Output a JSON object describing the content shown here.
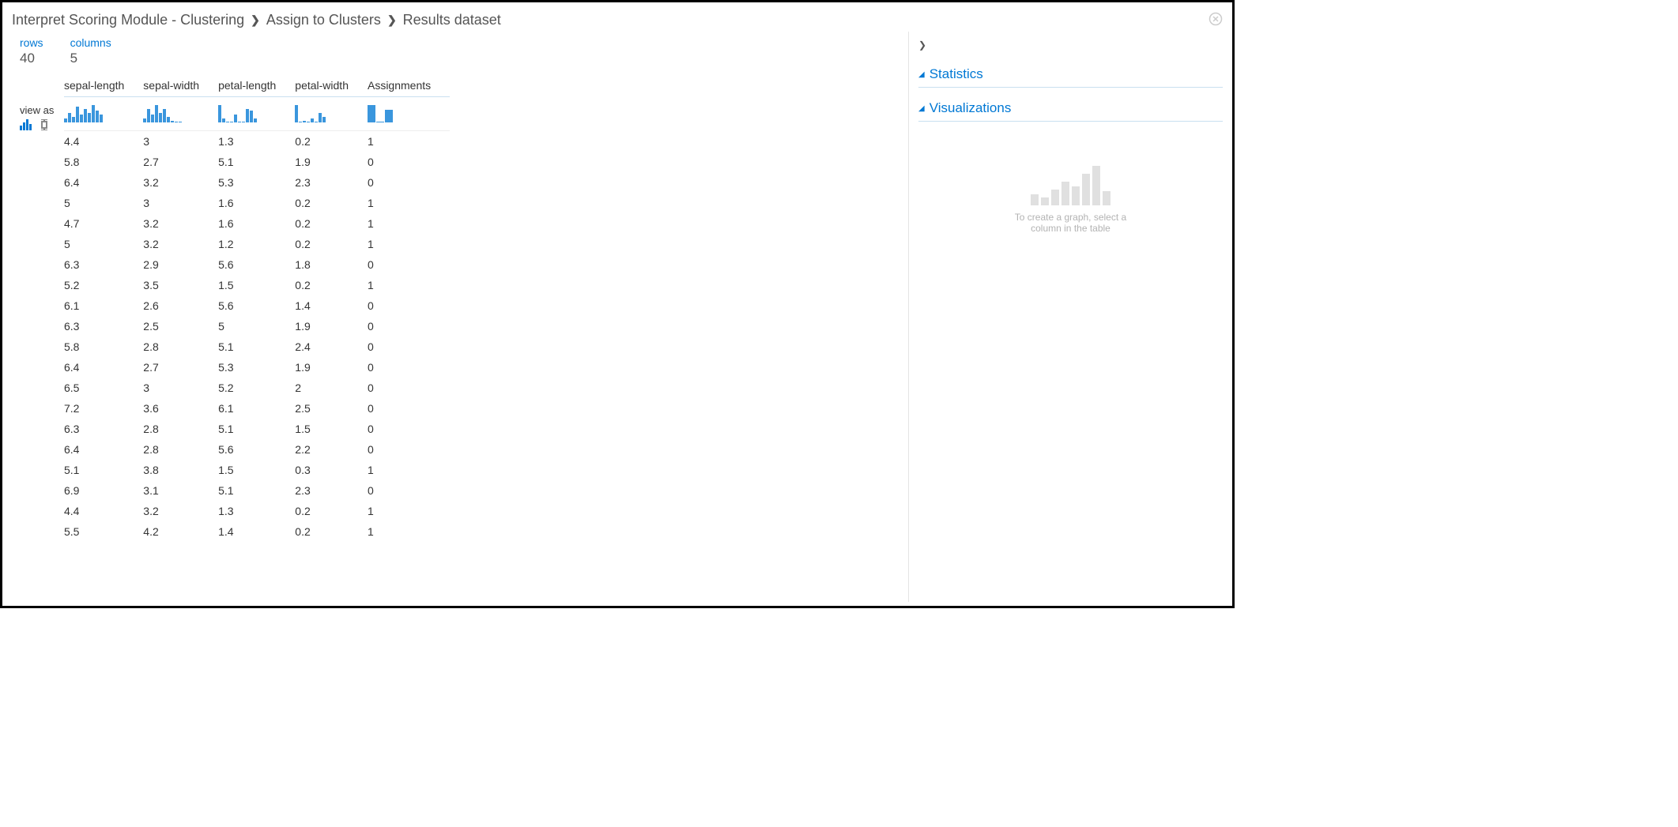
{
  "breadcrumb": {
    "seg1": "Interpret Scoring Module - Clustering",
    "seg2": "Assign to Clusters",
    "seg3": "Results dataset"
  },
  "meta": {
    "rows_label": "rows",
    "rows_value": "40",
    "cols_label": "columns",
    "cols_value": "5"
  },
  "viewas_label": "view as",
  "columns": [
    "sepal-length",
    "sepal-width",
    "petal-length",
    "petal-width",
    "Assignments"
  ],
  "rows": [
    [
      "4.4",
      "3",
      "1.3",
      "0.2",
      "1"
    ],
    [
      "5.8",
      "2.7",
      "5.1",
      "1.9",
      "0"
    ],
    [
      "6.4",
      "3.2",
      "5.3",
      "2.3",
      "0"
    ],
    [
      "5",
      "3",
      "1.6",
      "0.2",
      "1"
    ],
    [
      "4.7",
      "3.2",
      "1.6",
      "0.2",
      "1"
    ],
    [
      "5",
      "3.2",
      "1.2",
      "0.2",
      "1"
    ],
    [
      "6.3",
      "2.9",
      "5.6",
      "1.8",
      "0"
    ],
    [
      "5.2",
      "3.5",
      "1.5",
      "0.2",
      "1"
    ],
    [
      "6.1",
      "2.6",
      "5.6",
      "1.4",
      "0"
    ],
    [
      "6.3",
      "2.5",
      "5",
      "1.9",
      "0"
    ],
    [
      "5.8",
      "2.8",
      "5.1",
      "2.4",
      "0"
    ],
    [
      "6.4",
      "2.7",
      "5.3",
      "1.9",
      "0"
    ],
    [
      "6.5",
      "3",
      "5.2",
      "2",
      "0"
    ],
    [
      "7.2",
      "3.6",
      "6.1",
      "2.5",
      "0"
    ],
    [
      "6.3",
      "2.8",
      "5.1",
      "1.5",
      "0"
    ],
    [
      "6.4",
      "2.8",
      "5.6",
      "2.2",
      "0"
    ],
    [
      "5.1",
      "3.8",
      "1.5",
      "0.3",
      "1"
    ],
    [
      "6.9",
      "3.1",
      "5.1",
      "2.3",
      "0"
    ],
    [
      "4.4",
      "3.2",
      "1.3",
      "0.2",
      "1"
    ],
    [
      "5.5",
      "4.2",
      "1.4",
      "0.2",
      "1"
    ]
  ],
  "histograms": {
    "sepal-length": [
      4,
      10,
      6,
      16,
      8,
      14,
      10,
      18,
      12,
      8
    ],
    "sepal-width": [
      4,
      14,
      8,
      18,
      10,
      14,
      6,
      2,
      1,
      1
    ],
    "petal-length": [
      18,
      4,
      0,
      0,
      8,
      1,
      0,
      14,
      12,
      4
    ],
    "petal-width": [
      18,
      0,
      2,
      0,
      4,
      1,
      10,
      6
    ],
    "Assignments": [
      22,
      0,
      16
    ]
  },
  "right": {
    "statistics_label": "Statistics",
    "visualizations_label": "Visualizations",
    "placeholder_line1": "To create a graph, select a",
    "placeholder_line2": "column in the table"
  },
  "chart_data": [
    {
      "type": "bar",
      "title": "sepal-length header histogram",
      "categories": [],
      "values": [
        4,
        10,
        6,
        16,
        8,
        14,
        10,
        18,
        12,
        8
      ]
    },
    {
      "type": "bar",
      "title": "sepal-width header histogram",
      "categories": [],
      "values": [
        4,
        14,
        8,
        18,
        10,
        14,
        6,
        2,
        1,
        1
      ]
    },
    {
      "type": "bar",
      "title": "petal-length header histogram",
      "categories": [],
      "values": [
        18,
        4,
        0,
        0,
        8,
        1,
        0,
        14,
        12,
        4
      ]
    },
    {
      "type": "bar",
      "title": "petal-width header histogram",
      "categories": [],
      "values": [
        18,
        0,
        2,
        0,
        4,
        1,
        10,
        6
      ]
    },
    {
      "type": "bar",
      "title": "Assignments header histogram",
      "categories": [
        "0",
        "",
        "1"
      ],
      "values": [
        22,
        0,
        16
      ]
    }
  ]
}
